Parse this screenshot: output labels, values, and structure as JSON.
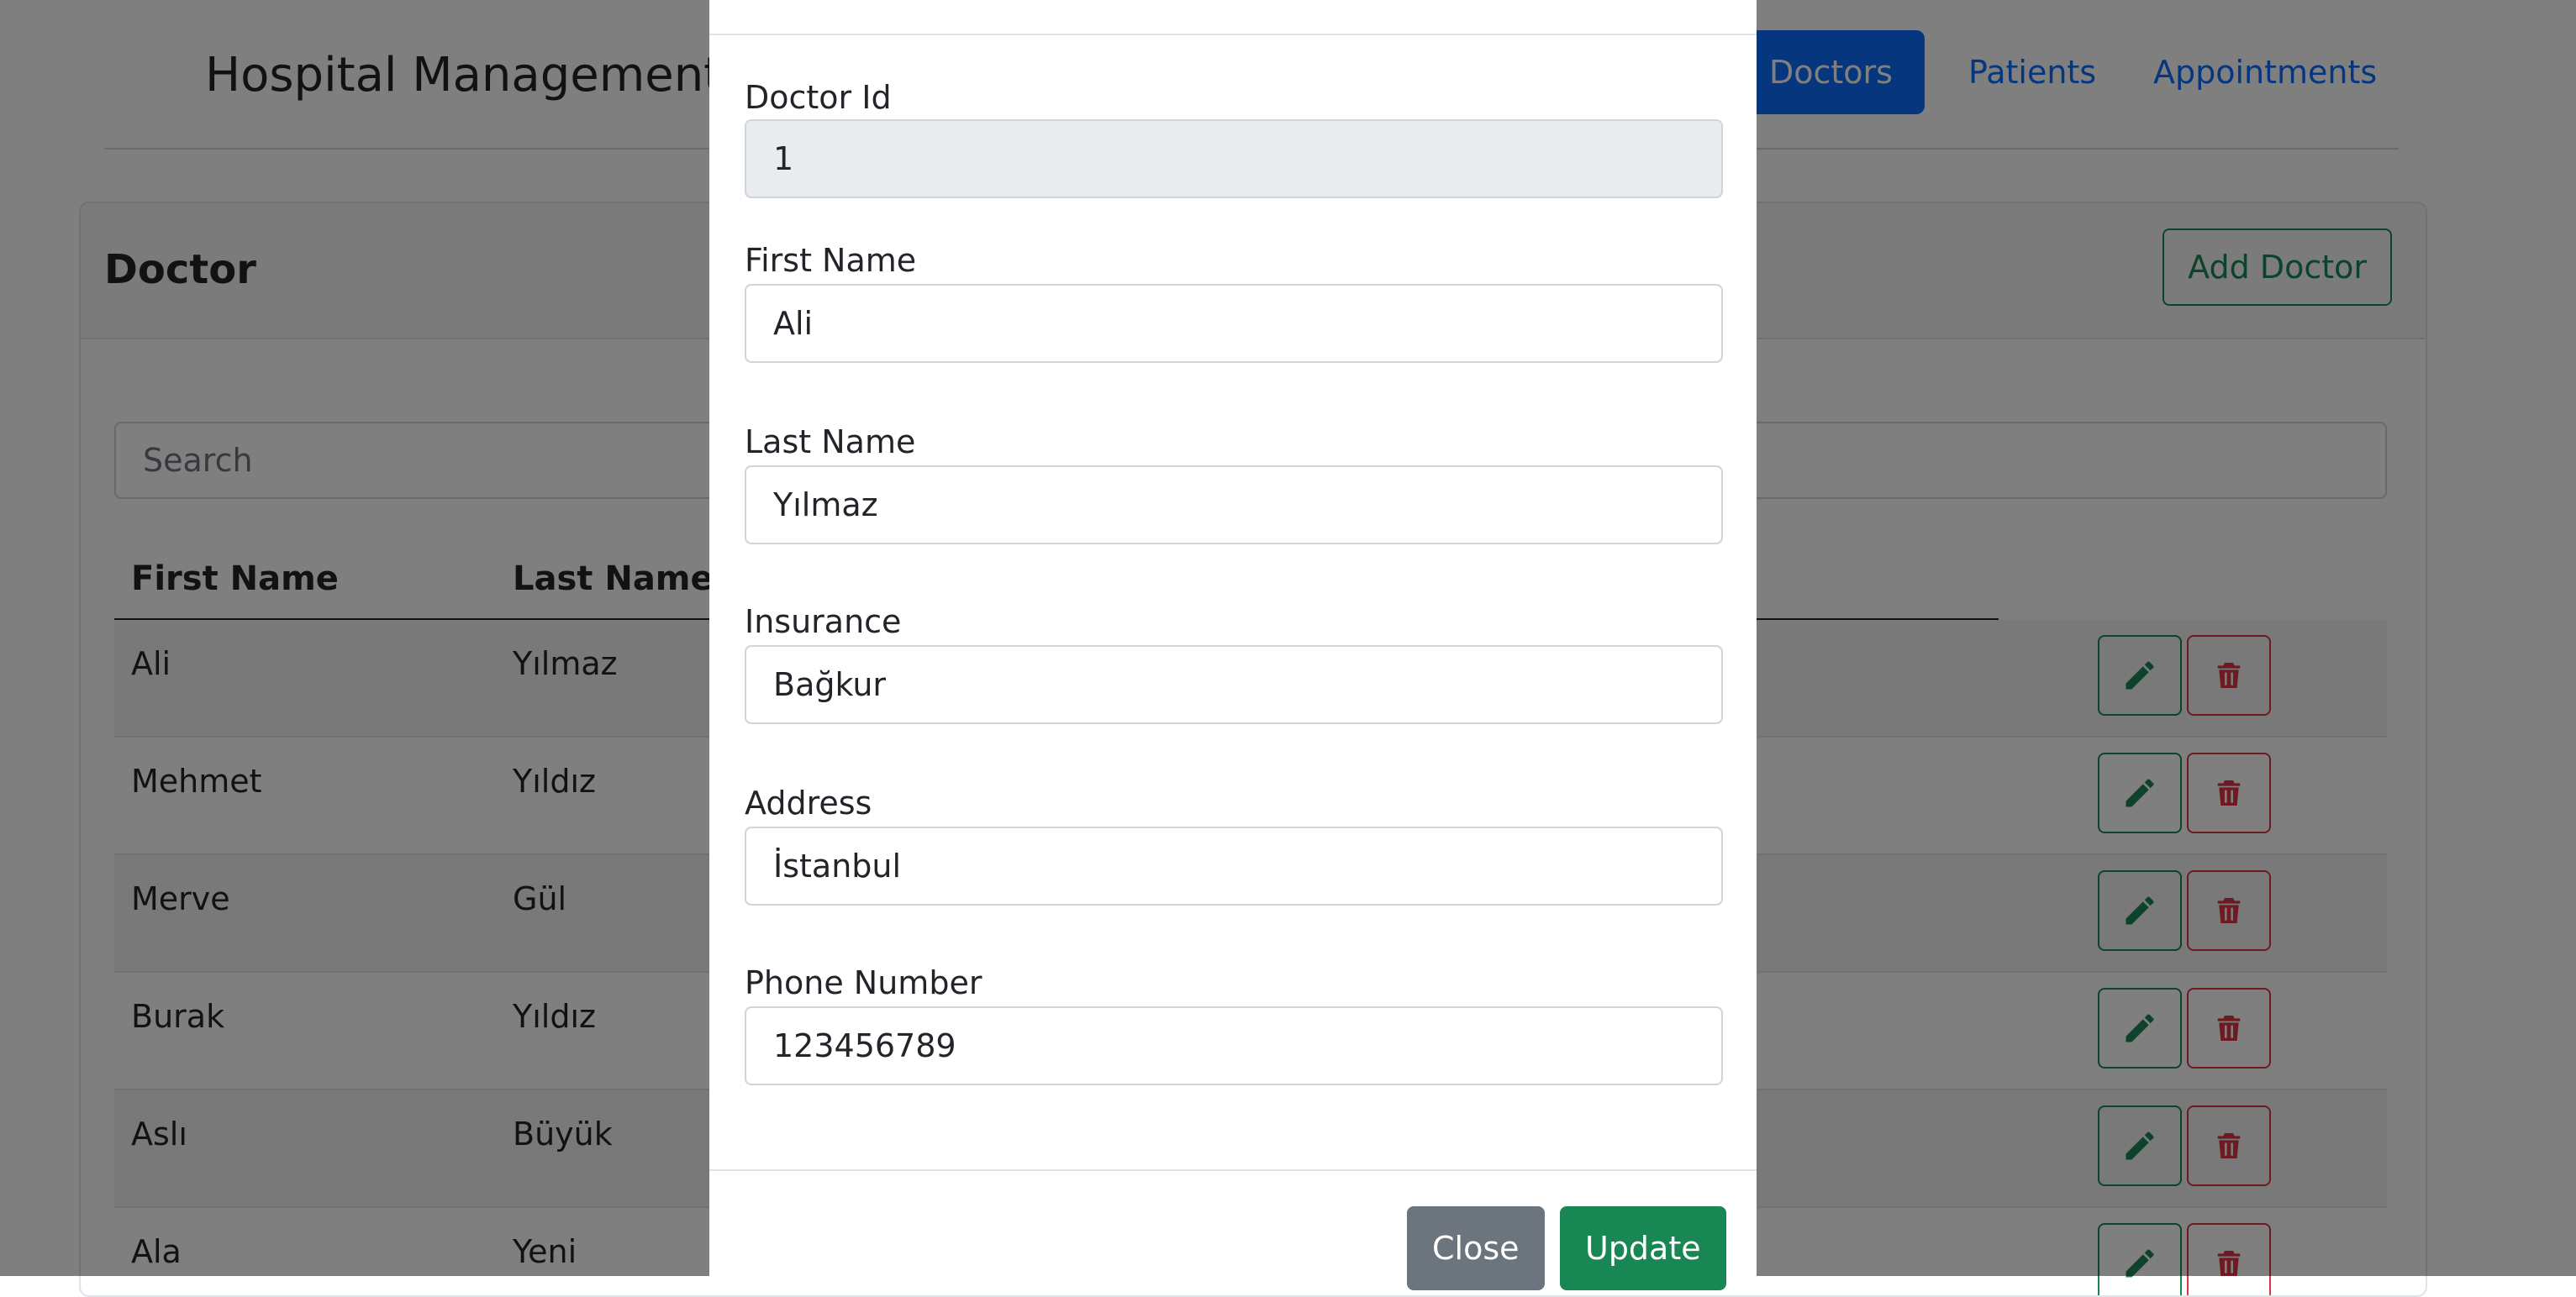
{
  "navbar": {
    "brand": "Hospital Management",
    "links": [
      {
        "label": "Doctors",
        "active": true
      },
      {
        "label": "Patients",
        "active": false
      },
      {
        "label": "Appointments",
        "active": false
      }
    ]
  },
  "doctor_card": {
    "title": "Doctor",
    "add_button": "Add Doctor",
    "search_placeholder": "Search",
    "columns": [
      "First Name",
      "Last Name"
    ],
    "rows": [
      {
        "first_name": "Ali",
        "last_name": "Yılmaz"
      },
      {
        "first_name": "Mehmet",
        "last_name": "Yıldız"
      },
      {
        "first_name": "Merve",
        "last_name": "Gül"
      },
      {
        "first_name": "Burak",
        "last_name": "Yıldız"
      },
      {
        "first_name": "Aslı",
        "last_name": "Büyük"
      },
      {
        "first_name": "Ala",
        "last_name": "Yeni"
      }
    ],
    "row_actions": {
      "edit_icon": "pencil-icon",
      "delete_icon": "trash-icon"
    }
  },
  "edit_modal": {
    "fields": {
      "doctor_id": {
        "label": "Doctor Id",
        "value": "1",
        "readonly": true
      },
      "first_name": {
        "label": "First Name",
        "value": "Ali"
      },
      "last_name": {
        "label": "Last Name",
        "value": "Yılmaz"
      },
      "insurance": {
        "label": "Insurance",
        "value": "Bağkur"
      },
      "address": {
        "label": "Address",
        "value": "İstanbul"
      },
      "phone_number": {
        "label": "Phone Number",
        "value": "123456789"
      }
    },
    "close_button": "Close",
    "update_button": "Update"
  },
  "colors": {
    "primary": "#0d6efd",
    "success": "#198754",
    "danger": "#dc3545",
    "secondary": "#6c757d",
    "backdrop": "rgba(0,0,0,0.5)"
  }
}
